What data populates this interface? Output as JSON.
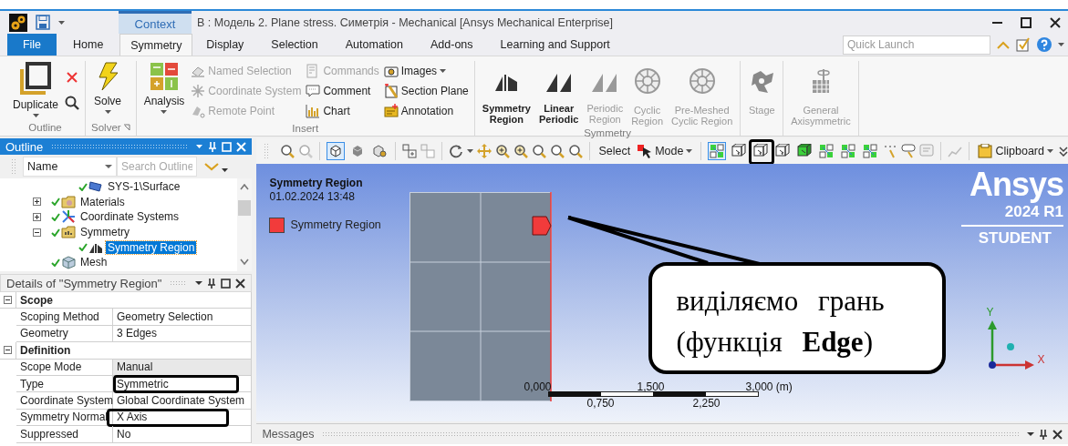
{
  "title_bar": {
    "context_label": "Context",
    "title": "B : Модель 2. Plane stress. Симетрія - Mechanical [Ansys Mechanical Enterprise]"
  },
  "ribbon_tabs": [
    {
      "label": "File",
      "kind": "file",
      "selected": false
    },
    {
      "label": "Home",
      "kind": "tab",
      "selected": false
    },
    {
      "label": "Symmetry",
      "kind": "tab",
      "selected": true
    },
    {
      "label": "Display",
      "kind": "tab",
      "selected": false
    },
    {
      "label": "Selection",
      "kind": "tab",
      "selected": false
    },
    {
      "label": "Automation",
      "kind": "tab",
      "selected": false
    },
    {
      "label": "Add-ons",
      "kind": "tab",
      "selected": false
    },
    {
      "label": "Learning and Support",
      "kind": "tab",
      "selected": false
    }
  ],
  "quick_launch": {
    "placeholder": "Quick Launch"
  },
  "ribbon_groups": [
    {
      "label": "Outline",
      "columns": [
        [
          {
            "kind": "large",
            "label": "Duplicate",
            "dropdown": true,
            "disabled": false
          }
        ],
        [
          {
            "kind": "icon",
            "disabled": false
          },
          {
            "kind": "icon",
            "disabled": false
          }
        ]
      ]
    },
    {
      "label": "Solver",
      "launcher": true,
      "columns": [
        [
          {
            "kind": "large",
            "label": "Solve",
            "dropdown": true,
            "disabled": false
          }
        ]
      ]
    },
    {
      "label": "Insert",
      "columns": [
        [
          {
            "kind": "large",
            "label": "Analysis",
            "dropdown": true,
            "disabled": false
          }
        ],
        [
          {
            "kind": "small",
            "label": "Named Selection",
            "dropdown": false,
            "disabled": true
          },
          {
            "kind": "small",
            "label": "Coordinate System",
            "dropdown": false,
            "disabled": true
          },
          {
            "kind": "small",
            "label": "Remote Point",
            "dropdown": false,
            "disabled": true
          }
        ],
        [
          {
            "kind": "small",
            "label": "Commands",
            "dropdown": false,
            "disabled": true
          },
          {
            "kind": "small",
            "label": "Comment",
            "dropdown": false,
            "disabled": false
          },
          {
            "kind": "small",
            "label": "Chart",
            "dropdown": false,
            "disabled": false
          }
        ],
        [
          {
            "kind": "small",
            "label": "Images",
            "dropdown": true,
            "disabled": false
          },
          {
            "kind": "small",
            "label": "Section Plane",
            "dropdown": false,
            "disabled": false
          },
          {
            "kind": "small",
            "label": "Annotation",
            "dropdown": false,
            "disabled": false
          }
        ]
      ]
    },
    {
      "label": "Symmetry",
      "columns": [
        [
          {
            "kind": "large",
            "label": "Symmetry\nRegion",
            "dropdown": false,
            "disabled": false
          }
        ],
        [
          {
            "kind": "large",
            "label": "Linear\nPeriodic",
            "dropdown": false,
            "disabled": false
          }
        ],
        [
          {
            "kind": "large",
            "label": "Periodic\nRegion",
            "dropdown": false,
            "disabled": true
          }
        ],
        [
          {
            "kind": "large",
            "label": "Cyclic\nRegion",
            "dropdown": false,
            "disabled": true
          }
        ],
        [
          {
            "kind": "large",
            "label": "Pre-Meshed\nCyclic Region",
            "dropdown": false,
            "disabled": true
          }
        ]
      ]
    },
    {
      "columns": [
        [
          {
            "kind": "large",
            "label": "Stage",
            "dropdown": false,
            "disabled": true
          }
        ]
      ]
    },
    {
      "columns": [
        [
          {
            "kind": "large",
            "label": "General\nAxisymmetric",
            "dropdown": false,
            "disabled": true
          }
        ]
      ]
    }
  ],
  "outline": {
    "title": "Outline",
    "filter": {
      "value": "Name"
    },
    "search": {
      "placeholder": "Search Outline"
    },
    "tree": [
      {
        "children": [
          {
            "label": "SYS-1\\Surface",
            "kind": "surface",
            "selected": false
          }
        ]
      },
      {
        "label": "Materials",
        "kind": "materials",
        "expanded": false,
        "selected": false
      },
      {
        "label": "Coordinate Systems",
        "kind": "coordinates",
        "expanded": false,
        "selected": false
      },
      {
        "label": "Symmetry",
        "kind": "folder",
        "expanded": true,
        "selected": false,
        "children": [
          {
            "label": "Symmetry Region",
            "kind": "symmetry",
            "selected": true
          }
        ]
      },
      {
        "label": "Mesh",
        "kind": "mesh",
        "selected": false
      }
    ]
  },
  "details": {
    "title": "Details of \"Symmetry Region\"",
    "sections": [
      {
        "title": "Scope",
        "expanded": true,
        "rows": [
          {
            "label": "Scoping Method",
            "value": "Geometry Selection",
            "read_only": false
          },
          {
            "label": "Geometry",
            "value": "3 Edges",
            "read_only": false
          }
        ]
      },
      {
        "title": "Definition",
        "expanded": true,
        "rows": [
          {
            "label": "Scope Mode",
            "value": "Manual",
            "read_only": true
          },
          {
            "label": "Type",
            "value": "Symmetric",
            "read_only": false,
            "highlighted": true
          },
          {
            "label": "Coordinate System",
            "value": "Global Coordinate System",
            "read_only": false
          },
          {
            "label": "Symmetry Normal",
            "value": "X Axis",
            "read_only": false,
            "highlighted": true
          },
          {
            "label": "Suppressed",
            "value": "No",
            "read_only": false
          }
        ]
      }
    ]
  },
  "toolbar": {
    "view_buttons": [
      {
        "selected": true
      },
      {
        "selected": false
      },
      {
        "selected": false
      }
    ],
    "select_label": "Select",
    "mode_label": "Mode",
    "filter_buttons": [
      {
        "selected": true
      },
      {
        "selected": false
      },
      {
        "selected": false,
        "highlighted": true
      },
      {
        "selected": false
      },
      {
        "selected": false
      },
      {
        "selected": false
      },
      {
        "selected": false
      },
      {
        "selected": false
      }
    ],
    "clipboard_label": "Clipboard"
  },
  "viewport": {
    "legend": {
      "title": "Symmetry Region",
      "date": "01.02.2024 13:48",
      "items": [
        {
          "label": "Symmetry Region",
          "color": "#f23b3b"
        }
      ]
    },
    "logo": {
      "name": "Ansys",
      "version": "2024 R1",
      "edition": "STUDENT"
    },
    "scale": {
      "top_labels": [
        "0,000",
        "1,500",
        "3,000 (m)"
      ],
      "bottom_labels": [
        "0,750",
        "2,250"
      ]
    },
    "triad": {
      "y_label": "Y",
      "x_label": "X"
    },
    "callout": {
      "lines": [
        "виділяємо грань",
        "(функція **Edge**)"
      ]
    }
  },
  "messages": {
    "title": "Messages"
  }
}
